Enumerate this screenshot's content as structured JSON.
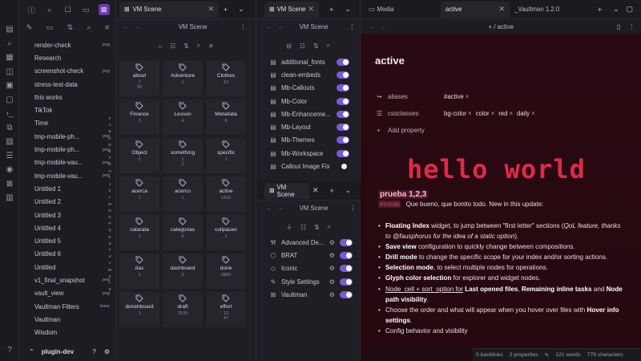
{
  "explorer": {
    "files": [
      {
        "name": "render-check",
        "ext": "png"
      },
      {
        "name": "Research",
        "ext": ""
      },
      {
        "name": "screenshot-check",
        "ext": "png"
      },
      {
        "name": "stress-test-data",
        "ext": ""
      },
      {
        "name": "this works",
        "ext": ""
      },
      {
        "name": "TikTok",
        "ext": ""
      },
      {
        "name": "Time",
        "ext": ""
      },
      {
        "name": "tmp-mobile-ph...",
        "ext": "png"
      },
      {
        "name": "tmp-mobile-ph...",
        "ext": "png"
      },
      {
        "name": "tmp-mobile-vau...",
        "ext": "png"
      },
      {
        "name": "tmp-mobile-vau...",
        "ext": "png"
      },
      {
        "name": "Untitled 1",
        "ext": ""
      },
      {
        "name": "Untitled 2",
        "ext": ""
      },
      {
        "name": "Untitled 3",
        "ext": ""
      },
      {
        "name": "Untitled 4",
        "ext": ""
      },
      {
        "name": "Untitled 5",
        "ext": ""
      },
      {
        "name": "Untitled 6",
        "ext": ""
      },
      {
        "name": "Untitled",
        "ext": ""
      },
      {
        "name": "v1_final_snapshot",
        "ext": "png"
      },
      {
        "name": "vault_view",
        "ext": "png"
      },
      {
        "name": "Vaultman Filters",
        "ext": "base"
      },
      {
        "name": "Vaultman",
        "ext": ""
      },
      {
        "name": "Wisdom",
        "ext": ""
      }
    ],
    "alphabet": [
      "#",
      "A",
      "B",
      "C",
      "D",
      "E",
      "F",
      "G",
      "H",
      "I",
      "J",
      "K",
      "L",
      "M",
      "N",
      "O",
      "P",
      "Q",
      "R",
      "S",
      "T",
      "U",
      "V",
      "W",
      "X",
      "Y",
      "Z"
    ],
    "vault_name": "plugin-dev"
  },
  "pane1": {
    "tab_label": "VM Scene",
    "nav_title": "VM Scene",
    "cards": [
      {
        "name": "about",
        "count": "7",
        "count2": "30"
      },
      {
        "name": "Adventure",
        "count": "1"
      },
      {
        "name": "Clothes",
        "count": "10"
      },
      {
        "name": "Finance",
        "count": "3"
      },
      {
        "name": "Lesson",
        "count": "4"
      },
      {
        "name": "Metadata",
        "count": "6"
      },
      {
        "name": "Object",
        "count": "3"
      },
      {
        "name": "something",
        "count": "1",
        "count2": "1"
      },
      {
        "name": "specific",
        "count": "1"
      },
      {
        "name": "acerca",
        "count": "1"
      },
      {
        "name": "acerco",
        "count": "1"
      },
      {
        "name": "active",
        "count": "1429"
      },
      {
        "name": "catarata",
        "count": "1"
      },
      {
        "name": "categorias",
        "count": "6"
      },
      {
        "name": "culipasen",
        "count": "1"
      },
      {
        "name": "das",
        "count": "1"
      },
      {
        "name": "dashboard",
        "count": "5"
      },
      {
        "name": "done",
        "count": "2860"
      },
      {
        "name": "donehboard",
        "count": "1"
      },
      {
        "name": "draft",
        "count": "2533"
      },
      {
        "name": "effort",
        "count": "12",
        "count2": "47"
      }
    ]
  },
  "pane2": {
    "tab_label": "VM Scene",
    "nav_title": "VM Scene",
    "snippets": [
      {
        "name": "additional_fonts",
        "on": true
      },
      {
        "name": "clean-embeds",
        "on": true
      },
      {
        "name": "Mb-Callouts",
        "on": true
      },
      {
        "name": "Mb-Color",
        "on": true
      },
      {
        "name": "Mb-Enhanceme...",
        "on": true
      },
      {
        "name": "Mb-Layout",
        "on": true
      },
      {
        "name": "Mb-Themes",
        "on": true
      },
      {
        "name": "Mb-Workspace",
        "on": true
      },
      {
        "name": "Callout Image Fix",
        "on": false
      }
    ],
    "lower_tab_label": "VM Scene",
    "lower_nav_title": "VM Scene",
    "plugins": [
      {
        "name": "Advanced De...",
        "on": true
      },
      {
        "name": "BRAT",
        "on": true
      },
      {
        "name": "Iconic",
        "on": true
      },
      {
        "name": "Style Settings",
        "on": true
      },
      {
        "name": "Vaultman",
        "on": true
      }
    ]
  },
  "pane3": {
    "tabs": [
      "Media",
      "active",
      "_Vaultman 1.2.0"
    ],
    "breadcrumb": "+ / active",
    "title": "active",
    "aliases_label": "aliases",
    "aliases": [
      "#active"
    ],
    "cssclasses_label": "cssclasses",
    "cssclasses": [
      "bg-color",
      "color",
      "red",
      "daily"
    ],
    "add_property": "Add property",
    "hello": "hello world",
    "prueba": "prueba 1,2,3",
    "moda_tag": "#moda",
    "intro": "Que bueno, que bonito todo. New in this update:",
    "status": {
      "backlinks": "0 backlinks",
      "properties": "2 properties",
      "words": "121 words",
      "chars": "779 characters"
    }
  }
}
